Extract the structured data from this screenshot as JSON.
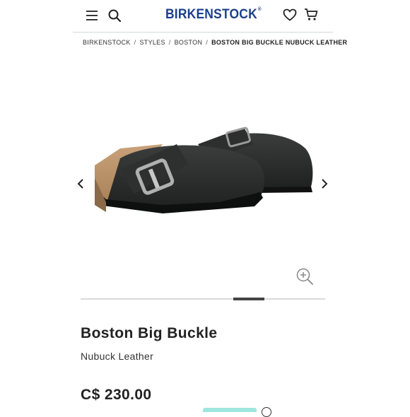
{
  "header": {
    "logo": "BIRKENSTOCK",
    "logo_mark": "®",
    "icons": [
      "menu-icon",
      "search-icon",
      "heart-icon",
      "cart-icon"
    ]
  },
  "breadcrumb": {
    "items": [
      "BIRKENSTOCK",
      "STYLES",
      "BOSTON"
    ],
    "current": "BOSTON BIG BUCKLE NUBUCK LEATHER",
    "separator": "/"
  },
  "gallery": {
    "controls": [
      "chevron-left-icon",
      "chevron-right-icon",
      "zoom-in-icon"
    ],
    "progress": 0.75
  },
  "product": {
    "name": "Boston Big Buckle",
    "material": "Nubuck Leather",
    "price": "C$ 230.00"
  },
  "colors": {
    "brand": "#1b3f8b",
    "divider": "#cfd8d8",
    "badge": "#9ee6e0"
  }
}
